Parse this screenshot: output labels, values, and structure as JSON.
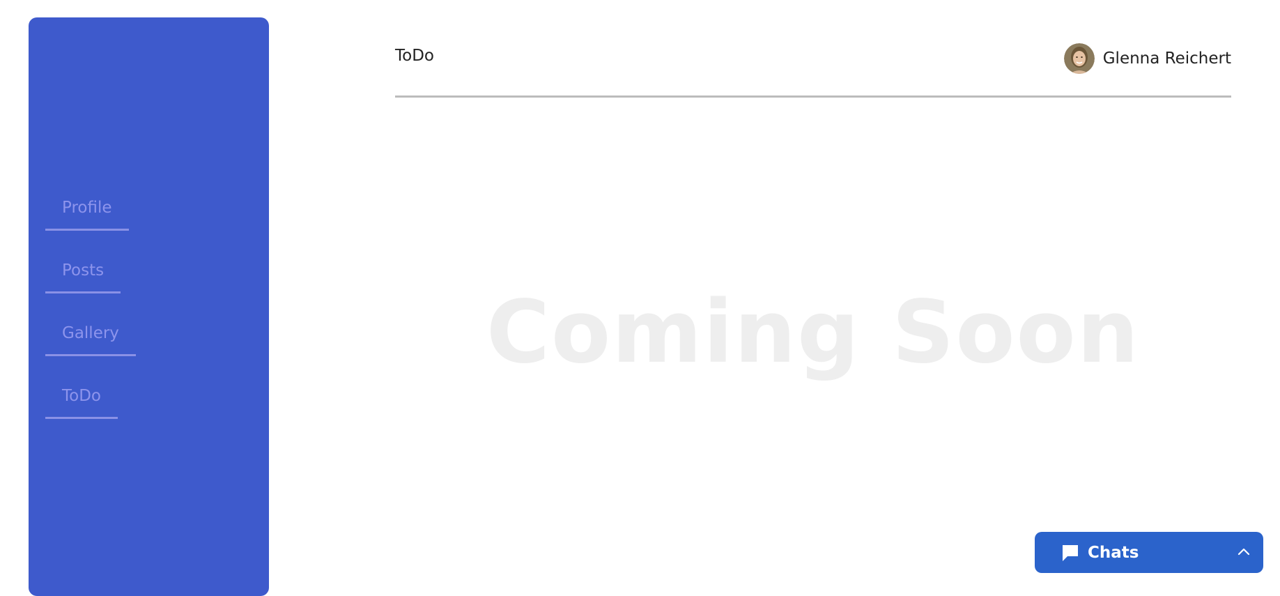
{
  "sidebar": {
    "background": "#3e5acc",
    "items": [
      {
        "label": "Profile"
      },
      {
        "label": "Posts"
      },
      {
        "label": "Gallery"
      },
      {
        "label": "ToDo"
      }
    ]
  },
  "header": {
    "title": "ToDo",
    "user_name": "Glenna Reichert",
    "avatar_icon": "user-avatar-photo"
  },
  "main": {
    "placeholder": "Coming Soon"
  },
  "chat_widget": {
    "label": "Chats",
    "icon": "chat-bubble-icon",
    "toggle_icon": "chevron-up-icon",
    "color": "#2b63cb"
  }
}
